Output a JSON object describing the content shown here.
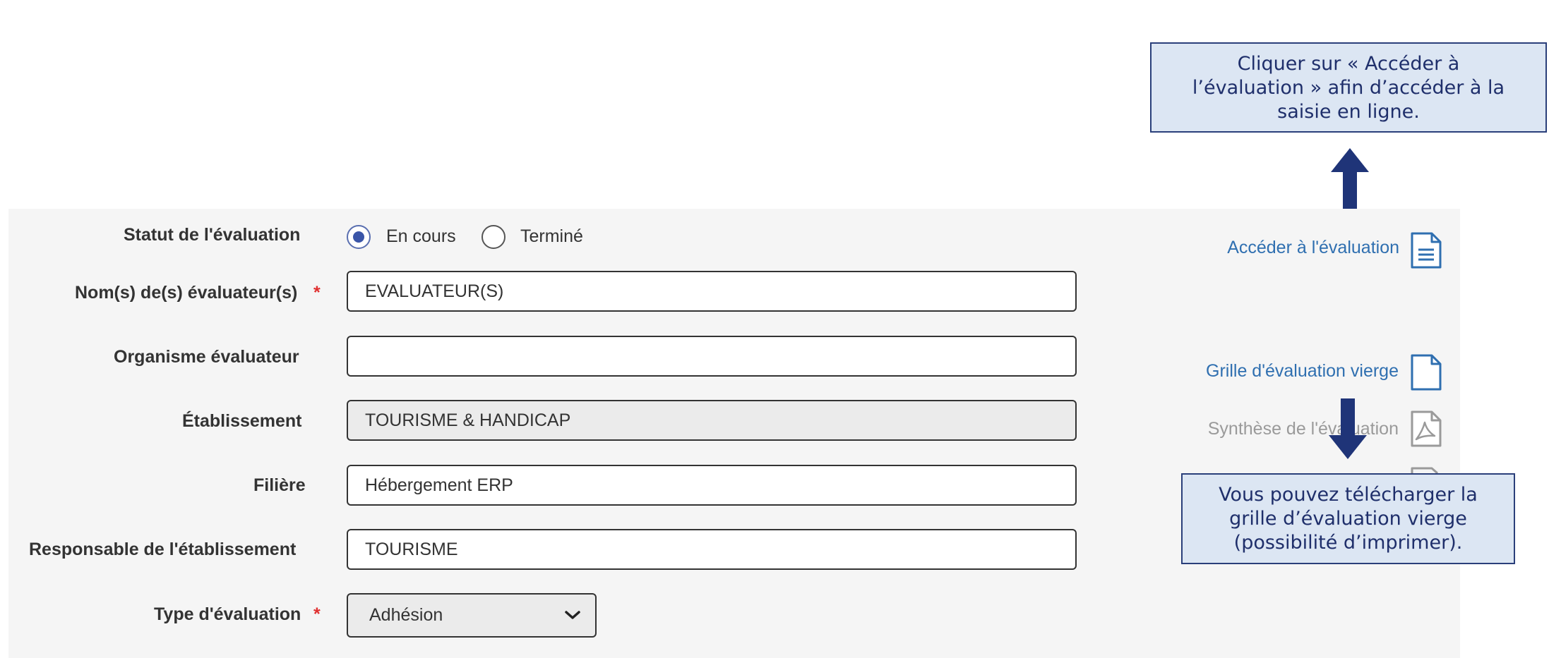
{
  "form": {
    "statut_label": "Statut de l'évaluation",
    "radio_en_cours": "En cours",
    "radio_termine": "Terminé",
    "evaluateurs_label": "Nom(s) de(s) évaluateur(s)",
    "evaluateurs_value": "EVALUATEUR(S)",
    "organisme_label": "Organisme évaluateur",
    "organisme_value": "",
    "etablissement_label": "Établissement",
    "etablissement_value": "TOURISME & HANDICAP",
    "filiere_label": "Filière",
    "filiere_value": "Hébergement ERP",
    "responsable_label": "Responsable de l'établissement",
    "responsable_value": "TOURISME",
    "type_label": "Type d'évaluation",
    "type_value": "Adhésion",
    "required_mark": "*"
  },
  "side": {
    "acceder": "Accéder à l'évaluation",
    "grille": "Grille d'évaluation vierge",
    "synthese": "Synthèse de l'évaluation"
  },
  "callouts": {
    "top_line1": "Cliquer sur « Accéder à",
    "top_line2": "l’évaluation » afin d’accéder à la",
    "top_line3": "saisie en ligne.",
    "bottom_line1": "Vous pouvez télécharger la",
    "bottom_line2": "grille d’évaluation vierge",
    "bottom_line3": "(possibilité d’imprimer)."
  },
  "colors": {
    "link": "#2f6fb0",
    "required": "#e03030",
    "callout_bg": "#dce6f3",
    "arrow": "#1f3478"
  },
  "icons": [
    "document-lines-icon",
    "blank-document-icon",
    "pdf-document-icon",
    "chevron-down-icon"
  ]
}
